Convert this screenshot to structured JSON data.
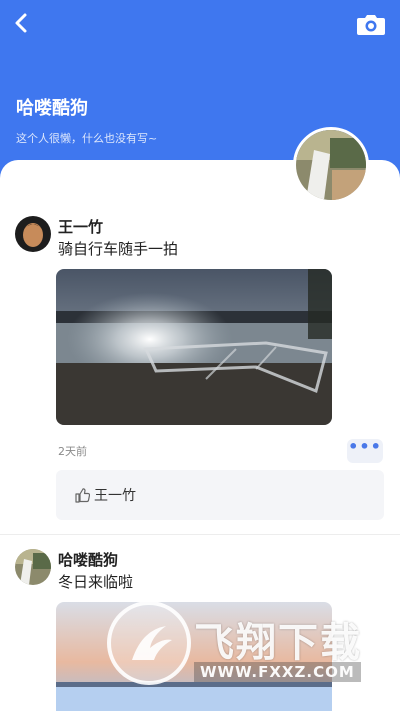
{
  "profile": {
    "name": "哈喽酷狗",
    "bio": "这个人很懒，什么也没有写~"
  },
  "posts": [
    {
      "author": "王一竹",
      "text": "骑自行车随手一拍",
      "time": "2天前",
      "more_label": "•••",
      "likes": "王一竹"
    },
    {
      "author": "哈喽酷狗",
      "text": "冬日来临啦"
    }
  ],
  "watermark": {
    "title": "飞翔下载",
    "url": "WWW.FXXZ.COM"
  },
  "colors": {
    "header": "#3f77ef",
    "accent": "#4a78e8"
  }
}
